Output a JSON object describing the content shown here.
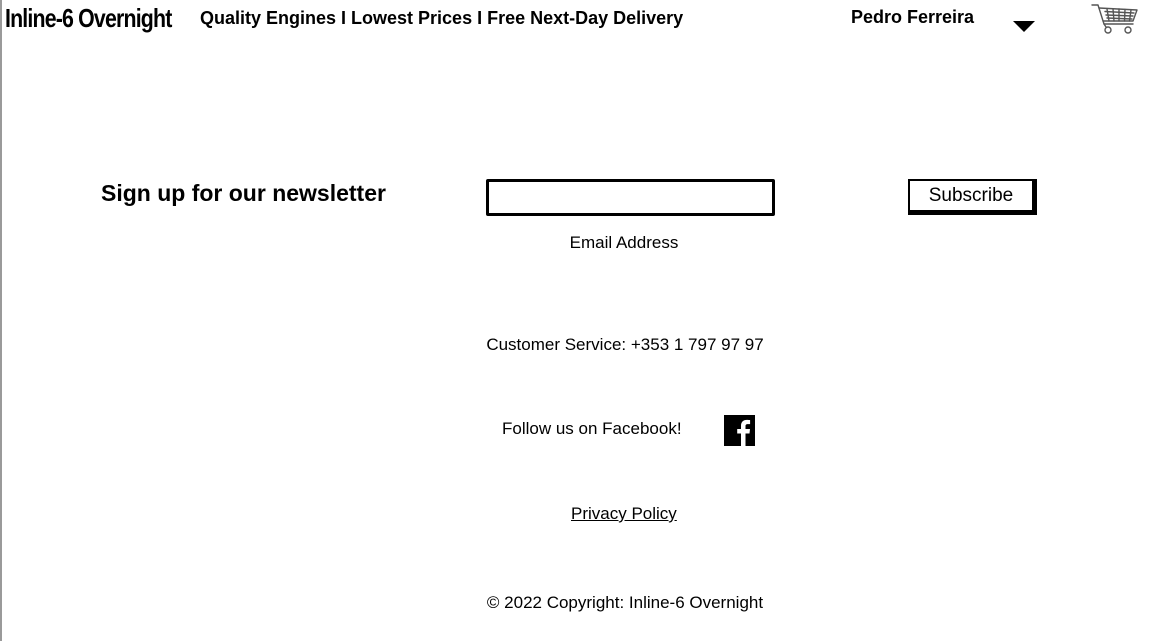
{
  "header": {
    "brand": "Inline-6 Overnight",
    "tagline": "Quality Engines I Lowest Prices I Free Next-Day Delivery",
    "user_name": "Pedro Ferreira",
    "icons": {
      "dropdown": "caret-down-icon",
      "cart": "shopping-cart-icon"
    }
  },
  "newsletter": {
    "heading": "Sign up for our newsletter",
    "email_value": "",
    "email_label": "Email Address",
    "subscribe_label": "Subscribe"
  },
  "footer": {
    "customer_service": "Customer Service: +353 1 797 97 97",
    "facebook_text": "Follow us on Facebook!",
    "facebook_icon": "facebook-icon",
    "privacy_policy": "Privacy Policy",
    "copyright": "© 2022 Copyright: Inline-6 Overnight"
  }
}
